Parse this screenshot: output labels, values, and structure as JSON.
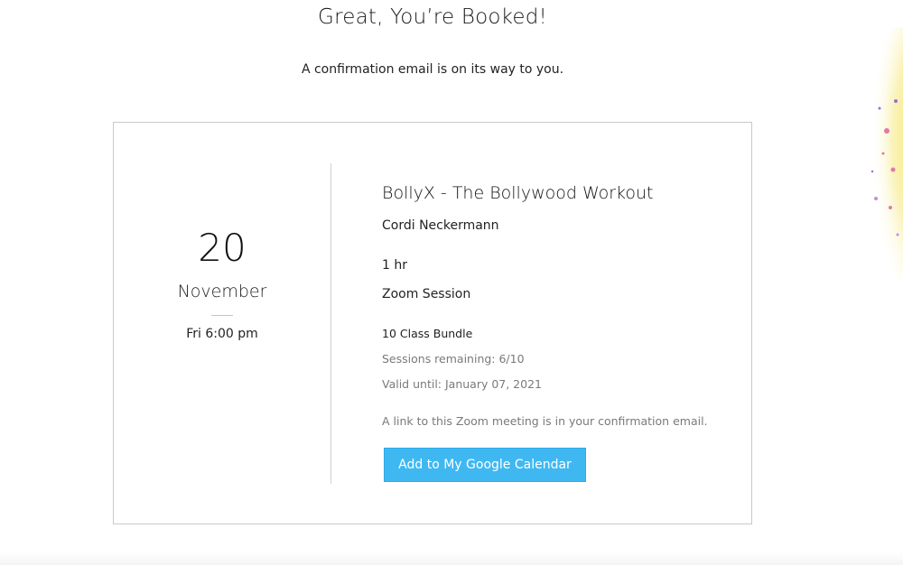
{
  "header": {
    "title": "Great, You’re Booked!",
    "subtitle": "A confirmation email is on its way to you."
  },
  "booking": {
    "day": "20",
    "month": "November",
    "weekday_time": "Fri 6:00 pm",
    "service_name": "BollyX - The Bollywood Workout",
    "staff_name": "Cordi Neckermann",
    "duration": "1 hr",
    "location": "Zoom Session",
    "plan": {
      "name": "10 Class Bundle",
      "sessions_remaining": "Sessions remaining: 6/10",
      "valid_until": "Valid until: January 07, 2021"
    },
    "zoom_note": "A link to this Zoom meeting is in your confirmation email.",
    "calendar_button_label": "Add to My Google Calendar"
  },
  "colors": {
    "button_bg": "#3fb8f2",
    "card_border": "#c9c9c9",
    "muted_text": "#7a7a7a",
    "splash_yellow": "#f3e35a",
    "splash_pink": "#e07aa8"
  }
}
